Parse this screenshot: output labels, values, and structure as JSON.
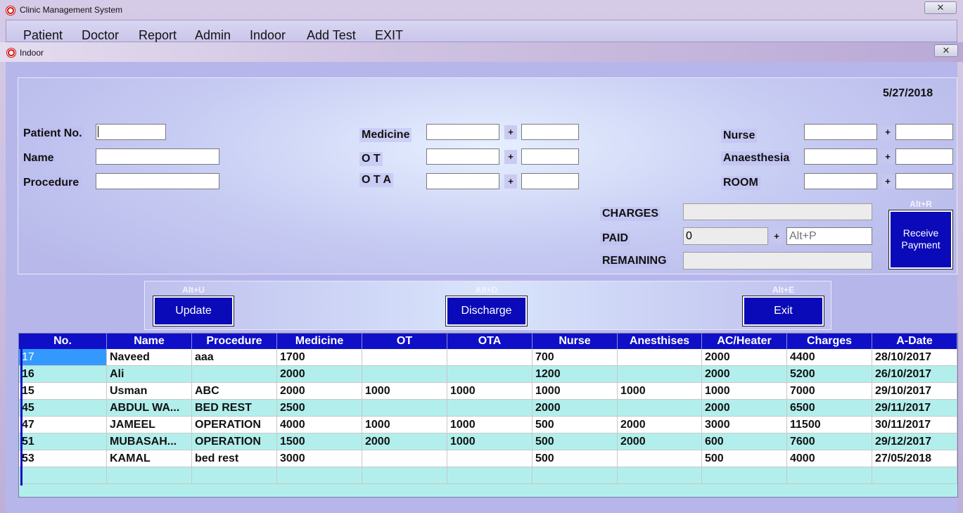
{
  "app": {
    "title": "Clinic Management System",
    "close": "✕"
  },
  "menu": [
    "Patient",
    "Doctor",
    "Report",
    "Admin",
    "Indoor",
    "Add Test",
    "EXIT"
  ],
  "child": {
    "title": "Indoor",
    "close": "✕"
  },
  "form": {
    "date": "5/27/2018",
    "patient_no_label": "Patient No.",
    "name_label": "Name",
    "procedure_label": "Procedure",
    "medicine_label": "Medicine",
    "ot_label": "O T",
    "ota_label": "O T A",
    "nurse_label": "Nurse",
    "anaesthesia_label": "Anaesthesia",
    "room_label": "ROOM",
    "plus": "+",
    "charges_label": "CHARGES",
    "paid_label": "PAID",
    "remaining_label": "REMAINING",
    "paid_value": "0",
    "paid_extra_placeholder": "Alt+P"
  },
  "buttons": {
    "receive_hotkey": "Alt+R",
    "receive": "Receive Payment",
    "update_hotkey": "Alt+U",
    "update": "Update",
    "discharge_hotkey": "Alt+D",
    "discharge": "Discharge",
    "exit_hotkey": "Alt+E",
    "exit": "Exit"
  },
  "grid": {
    "columns": [
      "No.",
      "Name",
      "Procedure",
      "Medicine",
      "OT",
      "OTA",
      "Nurse",
      "Anesthises",
      "AC/Heater",
      "Charges",
      "A-Date"
    ],
    "rows": [
      [
        "17",
        "Naveed",
        "aaa",
        "1700",
        "",
        "",
        "700",
        "",
        "2000",
        "4400",
        "28/10/2017"
      ],
      [
        "16",
        "Ali",
        "",
        "2000",
        "",
        "",
        "1200",
        "",
        "2000",
        "5200",
        "26/10/2017"
      ],
      [
        "15",
        "Usman",
        "ABC",
        "2000",
        "1000",
        "1000",
        "1000",
        "1000",
        "1000",
        "7000",
        "29/10/2017"
      ],
      [
        "45",
        "ABDUL WA...",
        "BED REST",
        "2500",
        "",
        "",
        "2000",
        "",
        "2000",
        "6500",
        "29/11/2017"
      ],
      [
        "47",
        "JAMEEL",
        "OPERATION",
        "4000",
        "1000",
        "1000",
        "500",
        "2000",
        "3000",
        "11500",
        "30/11/2017"
      ],
      [
        "51",
        "MUBASAH...",
        "OPERATION",
        "1500",
        "2000",
        "1000",
        "500",
        "2000",
        "600",
        "7600",
        "29/12/2017"
      ],
      [
        "53",
        "KAMAL",
        "bed rest",
        "3000",
        "",
        "",
        "500",
        "",
        "500",
        "4000",
        "27/05/2018"
      ]
    ],
    "row_colors": [
      "#ffffff",
      "#b2efec"
    ],
    "header_color": "#0f0fc7",
    "selected_color": "#3399ff"
  }
}
